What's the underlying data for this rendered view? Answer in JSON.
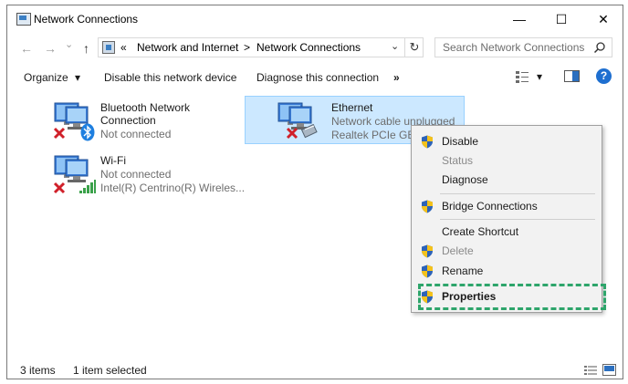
{
  "window": {
    "title": "Network Connections",
    "minimize": "—",
    "maximize": "☐",
    "close": "✕"
  },
  "address": {
    "back": "←",
    "forward": "→",
    "dropdown_small": "⌄",
    "up": "↑",
    "chevrons": "«",
    "crumb1": "Network and Internet",
    "sep": ">",
    "crumb2": "Network Connections",
    "dropdown": "⌄",
    "refresh": "↻",
    "search_placeholder": "Search Network Connections"
  },
  "toolbar": {
    "organize": "Organize",
    "organize_arrow": "▾",
    "disable": "Disable this network device",
    "diagnose": "Diagnose this connection",
    "more": "»",
    "view_arrow": "▾",
    "help": "?"
  },
  "items": [
    {
      "name": "Bluetooth Network",
      "name2": "Connection",
      "line1": "Not connected",
      "line2": ""
    },
    {
      "name": "Ethernet",
      "line1": "Network cable unplugged",
      "line2": "Realtek PCIe GBE Fa"
    },
    {
      "name": "Wi-Fi",
      "line1": "Not connected",
      "line2": "Intel(R) Centrino(R) Wireles..."
    }
  ],
  "context_menu": [
    {
      "label": "Disable",
      "shield": true,
      "enabled": true
    },
    {
      "label": "Status",
      "shield": false,
      "enabled": false
    },
    {
      "label": "Diagnose",
      "shield": false,
      "enabled": true
    },
    {
      "label": "Bridge Connections",
      "shield": true,
      "enabled": true
    },
    {
      "label": "Create Shortcut",
      "shield": false,
      "enabled": true
    },
    {
      "label": "Delete",
      "shield": true,
      "enabled": false
    },
    {
      "label": "Rename",
      "shield": true,
      "enabled": true
    },
    {
      "label": "Properties",
      "shield": true,
      "enabled": true,
      "default": true
    }
  ],
  "status": {
    "count": "3 items",
    "selected": "1 item selected"
  },
  "colors": {
    "selection_bg": "#cce8ff",
    "highlight_border": "#2ea56b",
    "shield_blue": "#2d63b8",
    "shield_yellow": "#f4c21b"
  }
}
